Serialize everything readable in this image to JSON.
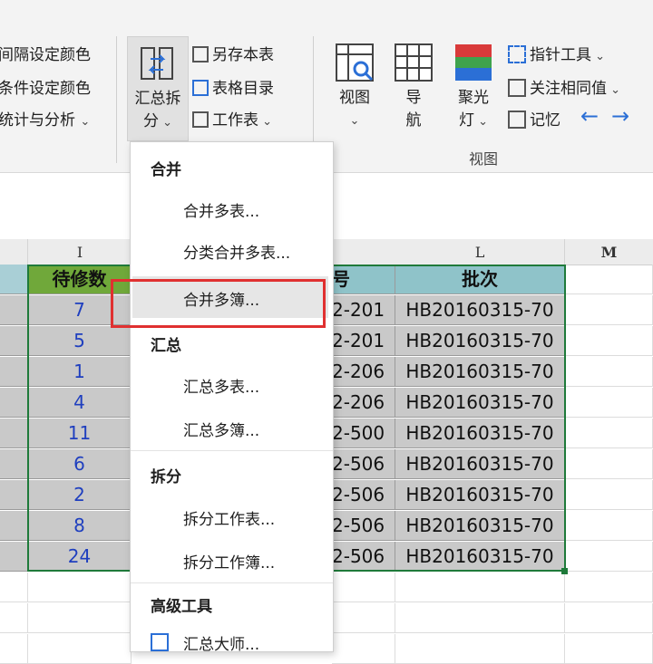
{
  "ribbon": {
    "left_group": [
      "间隔设定颜色",
      "条件设定颜色",
      "统计与分析"
    ],
    "summary_split": {
      "line1": "汇总拆",
      "line2": "分"
    },
    "save_group": [
      "另存本表",
      "表格目录",
      "工作表"
    ],
    "view_buttons": [
      {
        "line1": "视图",
        "line2": ""
      },
      {
        "line1": "导",
        "line2": "航"
      },
      {
        "line1": "聚光",
        "line2": "灯"
      }
    ],
    "right_group": [
      "指针工具",
      "关注相同值",
      "记忆"
    ],
    "view_group_label": "视图",
    "colors": {
      "accent_blue": "#2b6fd6",
      "spotlight": [
        "#d93a3a",
        "#3fa34d",
        "#2b6fd6"
      ]
    }
  },
  "sheet": {
    "col_headers": [
      "I",
      "L",
      "M"
    ],
    "table_headers": [
      "待修数",
      "号",
      "批次"
    ],
    "rows": [
      {
        "count": "7",
        "code": "2-201",
        "batch": "HB20160315-70"
      },
      {
        "count": "5",
        "code": "2-201",
        "batch": "HB20160315-70"
      },
      {
        "count": "1",
        "code": "2-206",
        "batch": "HB20160315-70"
      },
      {
        "count": "4",
        "code": "2-206",
        "batch": "HB20160315-70"
      },
      {
        "count": "11",
        "code": "2-500",
        "batch": "HB20160315-70"
      },
      {
        "count": "6",
        "code": "2-506",
        "batch": "HB20160315-70"
      },
      {
        "count": "2",
        "code": "2-506",
        "batch": "HB20160315-70"
      },
      {
        "count": "8",
        "code": "2-506",
        "batch": "HB20160315-70"
      },
      {
        "count": "24",
        "code": "2-506",
        "batch": "HB20160315-70"
      }
    ],
    "colors": {
      "header_green": "#70a83a",
      "header_teal": "#8fc3c9",
      "cell_grey": "#c9c9c9",
      "count_blue": "#1f3fbf"
    }
  },
  "menu": {
    "section_merge": "合并",
    "merge_items": [
      "合并多表...",
      "分类合并多表...",
      "合并多簿..."
    ],
    "section_summary": "汇总",
    "summary_items": [
      "汇总多表...",
      "汇总多簿..."
    ],
    "section_split": "拆分",
    "split_items": [
      "拆分工作表...",
      "拆分工作簿..."
    ],
    "section_advanced": "高级工具",
    "advanced_items": [
      "汇总大师..."
    ],
    "highlight_color": "#e03030"
  }
}
